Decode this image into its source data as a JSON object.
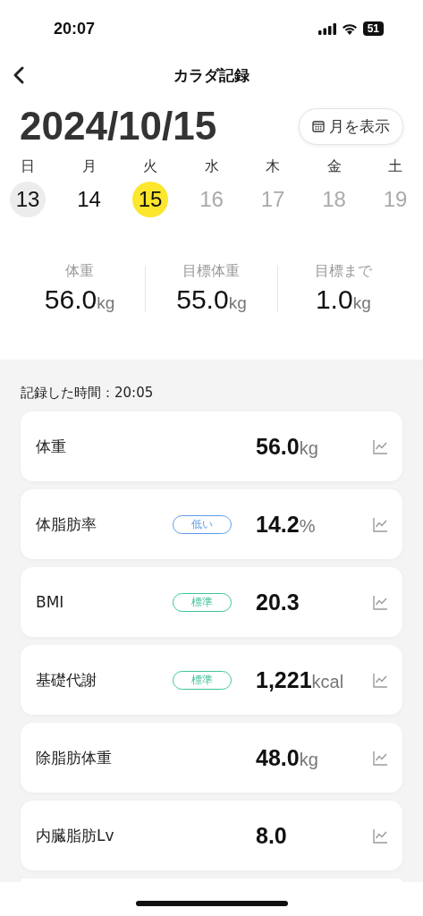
{
  "status_bar": {
    "time": "20:07",
    "battery": "51"
  },
  "nav": {
    "title": "カラダ記録"
  },
  "date": "2024/10/15",
  "month_button": "月を表示",
  "week": [
    {
      "weekday": "日",
      "day": "13",
      "selected": false,
      "kind": "marked"
    },
    {
      "weekday": "月",
      "day": "14",
      "selected": false,
      "kind": "past"
    },
    {
      "weekday": "火",
      "day": "15",
      "selected": true,
      "kind": "past"
    },
    {
      "weekday": "水",
      "day": "16",
      "selected": false,
      "kind": "future"
    },
    {
      "weekday": "木",
      "day": "17",
      "selected": false,
      "kind": "future"
    },
    {
      "weekday": "金",
      "day": "18",
      "selected": false,
      "kind": "future"
    },
    {
      "weekday": "土",
      "day": "19",
      "selected": false,
      "kind": "future"
    }
  ],
  "summary": [
    {
      "label": "体重",
      "value": "56.0",
      "unit": "kg"
    },
    {
      "label": "目標体重",
      "value": "55.0",
      "unit": "kg"
    },
    {
      "label": "目標まで",
      "value": "1.0",
      "unit": "kg"
    }
  ],
  "record_time": "記録した時間：20:05",
  "metrics": [
    {
      "name": "体重",
      "value": "56.0",
      "unit": "kg"
    },
    {
      "name": "体脂肪率",
      "badge": {
        "text": "低い",
        "color": "#5b9be6"
      },
      "value": "14.2",
      "unit": "%"
    },
    {
      "name": "BMI",
      "badge": {
        "text": "標準",
        "color": "#3cc39c"
      },
      "value": "20.3"
    },
    {
      "name": "基礎代謝",
      "badge": {
        "text": "標準",
        "color": "#3cc39c"
      },
      "value": "1,221",
      "unit": "kcal"
    },
    {
      "name": "除脂肪体重",
      "value": "48.0",
      "unit": "kg"
    },
    {
      "name": "内臓脂肪Lv",
      "value": "8.0"
    }
  ]
}
